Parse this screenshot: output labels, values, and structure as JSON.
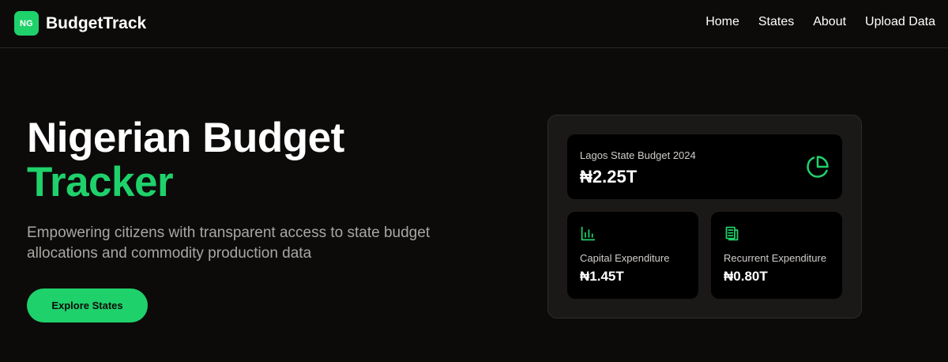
{
  "brand": {
    "badge": "NG",
    "name": "BudgetTrack"
  },
  "nav": {
    "items": [
      "Home",
      "States",
      "About",
      "Upload Data"
    ]
  },
  "hero": {
    "title_line1": "Nigerian Budget",
    "title_line2": "Tracker",
    "subtitle": "Empowering citizens with transparent access to state budget allocations and commodity production data",
    "cta_label": "Explore States"
  },
  "summary": {
    "main": {
      "label": "Lagos State Budget 2024",
      "value": "₦2.25T",
      "icon": "pie-chart-icon"
    },
    "capital": {
      "label": "Capital Expenditure",
      "value": "₦1.45T",
      "icon": "bar-chart-icon"
    },
    "recurrent": {
      "label": "Recurrent Expenditure",
      "value": "₦0.80T",
      "icon": "receipt-icon"
    }
  },
  "colors": {
    "accent": "#1fd16b",
    "background": "#0c0b0a",
    "panel": "#1b1917",
    "card": "#000000",
    "muted_text": "#a9a7a4"
  }
}
